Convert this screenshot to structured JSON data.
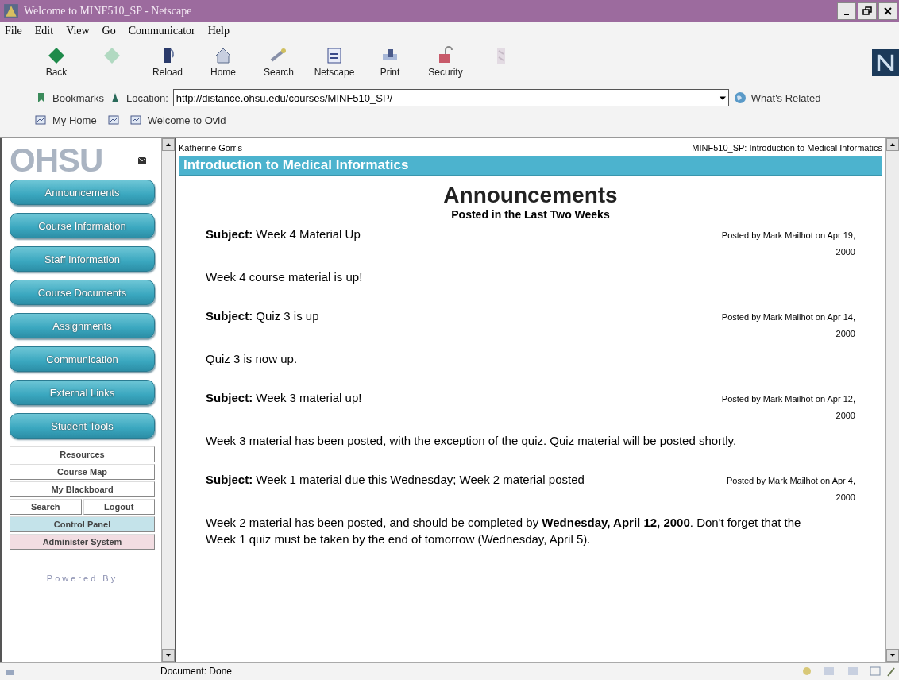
{
  "window": {
    "title": "Welcome to MINF510_SP - Netscape"
  },
  "menu": [
    "File",
    "Edit",
    "View",
    "Go",
    "Communicator",
    "Help"
  ],
  "toolbar": [
    {
      "kind": "back",
      "label": "Back",
      "disabled": false
    },
    {
      "kind": "forward",
      "disabled": true
    },
    {
      "kind": "reload",
      "label": "Reload",
      "disabled": false
    },
    {
      "kind": "home",
      "label": "Home",
      "disabled": false
    },
    {
      "kind": "search",
      "label": "Search",
      "disabled": false
    },
    {
      "kind": "mynetscape",
      "label": "Netscape",
      "disabled": false
    },
    {
      "kind": "print",
      "label": "Print",
      "disabled": false
    },
    {
      "kind": "security",
      "label": "Security",
      "disabled": false
    },
    {
      "kind": "stop",
      "disabled": true
    }
  ],
  "location": {
    "bookmarks": "Bookmarks",
    "label": "Location:",
    "url": "http://distance.ohsu.edu/courses/MINF510_SP/",
    "related": "What's Related"
  },
  "personal_bar": [
    {
      "kind": "link",
      "label": "My Home"
    },
    {
      "kind": "icon"
    },
    {
      "kind": "link",
      "label": "Welcome to Ovid"
    }
  ],
  "sidebar": {
    "logo": "OHSU",
    "buttons": [
      "Announcements",
      "Course Information",
      "Staff Information",
      "Course Documents",
      "Assignments",
      "Communication",
      "External Links",
      "Student Tools"
    ],
    "links": [
      {
        "row": [
          "Resources"
        ],
        "color": "#ffffff"
      },
      {
        "row": [
          "Course Map"
        ],
        "color": "#ffffff"
      },
      {
        "row": [
          "My Blackboard"
        ],
        "color": "#ffffff"
      },
      {
        "row": [
          "Search",
          "Logout"
        ],
        "color": "#ffffff"
      },
      {
        "row": [
          "Control Panel"
        ],
        "color": "#c4e3ea"
      },
      {
        "row": [
          "Administer System"
        ],
        "color": "#f2dde2"
      }
    ],
    "powered": "Powered By"
  },
  "content": {
    "user": "Katherine Gorris",
    "course_label": "MINF510_SP: Introduction to Medical Informatics",
    "banner": "Introduction to Medical Informatics",
    "heading": "Announcements",
    "subheading": "Posted in the Last Two Weeks",
    "announcements": [
      {
        "subject_label": "Subject:",
        "subject": "Week 4 Material Up",
        "posted": "Posted by Mark Mailhot on Apr 19, 2000",
        "body": "Week 4 course material is up!"
      },
      {
        "subject_label": "Subject:",
        "subject": "Quiz 3 is up",
        "posted": "Posted by Mark Mailhot on Apr 14, 2000",
        "body": "Quiz 3 is now up."
      },
      {
        "subject_label": "Subject:",
        "subject": "Week 3 material up!",
        "posted": "Posted by Mark Mailhot on Apr 12, 2000",
        "body": "Week 3 material has been posted, with the exception of the quiz. Quiz material will be posted shortly."
      },
      {
        "subject_label": "Subject:",
        "subject": "Week 1 material due this Wednesday; Week 2 material posted",
        "posted": "Posted by Mark Mailhot on Apr 4, 2000",
        "body": "Week 2 material has been posted, and should be completed by **Wednesday, April 12, 2000**. Don't forget that the Week 1 quiz must be taken by the end of tomorrow (Wednesday, April 5)."
      }
    ]
  },
  "status_bar": {
    "text": "Document: Done"
  }
}
